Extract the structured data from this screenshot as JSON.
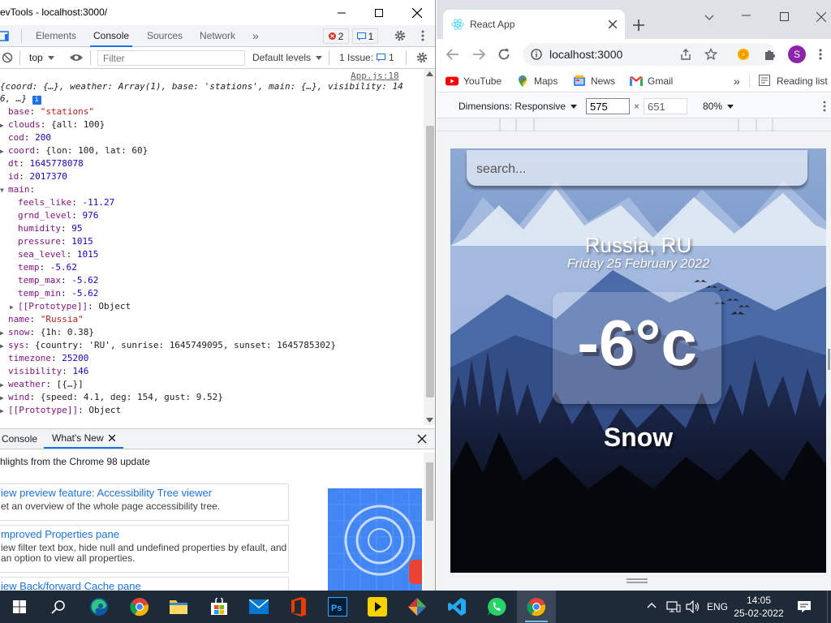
{
  "devtools": {
    "title": "evTools - localhost:3000/",
    "tabs": [
      "Elements",
      "Console",
      "Sources",
      "Network"
    ],
    "more_tabs": "»",
    "error_count": "2",
    "message_count": "1",
    "context": "top",
    "filter_placeholder": "Filter",
    "levels": "Default levels",
    "issues": "1 Issue:",
    "issues_count": "1",
    "source_link": "App.js:18",
    "summary_line1": "{coord: {…}, weather: Array(1), base: 'stations', main: {…}, visibility: 14",
    "summary_line2": "6, …}",
    "props": [
      {
        "indent": 0,
        "exp": "",
        "key": "base",
        "val": "\"stations\"",
        "t": "str"
      },
      {
        "indent": 0,
        "exp": "▶",
        "key": "clouds",
        "val": "{all: 100}",
        "t": "plain"
      },
      {
        "indent": 0,
        "exp": "",
        "key": "cod",
        "val": "200",
        "t": "num"
      },
      {
        "indent": 0,
        "exp": "▶",
        "key": "coord",
        "val": "{lon: 100, lat: 60}",
        "t": "plain"
      },
      {
        "indent": 0,
        "exp": "",
        "key": "dt",
        "val": "1645778078",
        "t": "num"
      },
      {
        "indent": 0,
        "exp": "",
        "key": "id",
        "val": "2017370",
        "t": "num"
      },
      {
        "indent": 0,
        "exp": "▼",
        "key": "main",
        "val": "",
        "t": "plain"
      },
      {
        "indent": 1,
        "exp": "",
        "key": "feels_like",
        "val": "-11.27",
        "t": "num"
      },
      {
        "indent": 1,
        "exp": "",
        "key": "grnd_level",
        "val": "976",
        "t": "num"
      },
      {
        "indent": 1,
        "exp": "",
        "key": "humidity",
        "val": "95",
        "t": "num"
      },
      {
        "indent": 1,
        "exp": "",
        "key": "pressure",
        "val": "1015",
        "t": "num"
      },
      {
        "indent": 1,
        "exp": "",
        "key": "sea_level",
        "val": "1015",
        "t": "num"
      },
      {
        "indent": 1,
        "exp": "",
        "key": "temp",
        "val": "-5.62",
        "t": "num"
      },
      {
        "indent": 1,
        "exp": "",
        "key": "temp_max",
        "val": "-5.62",
        "t": "num"
      },
      {
        "indent": 1,
        "exp": "",
        "key": "temp_min",
        "val": "-5.62",
        "t": "num"
      },
      {
        "indent": 1,
        "exp": "▶",
        "key": "[[Prototype]]",
        "val": "Object",
        "t": "plain"
      },
      {
        "indent": 0,
        "exp": "",
        "key": "name",
        "val": "\"Russia\"",
        "t": "str"
      },
      {
        "indent": 0,
        "exp": "▶",
        "key": "snow",
        "val": "{1h: 0.38}",
        "t": "plain"
      },
      {
        "indent": 0,
        "exp": "▶",
        "key": "sys",
        "val": "{country: 'RU', sunrise: 1645749095, sunset: 1645785302}",
        "t": "plain"
      },
      {
        "indent": 0,
        "exp": "",
        "key": "timezone",
        "val": "25200",
        "t": "num"
      },
      {
        "indent": 0,
        "exp": "",
        "key": "visibility",
        "val": "146",
        "t": "num"
      },
      {
        "indent": 0,
        "exp": "▶",
        "key": "weather",
        "val": "[{…}]",
        "t": "plain"
      },
      {
        "indent": 0,
        "exp": "▶",
        "key": "wind",
        "val": "{speed: 4.1, deg: 154, gust: 9.52}",
        "t": "plain"
      },
      {
        "indent": 0,
        "exp": "▶",
        "key": "[[Prototype]]",
        "val": "Object",
        "t": "plain"
      }
    ],
    "drawer": {
      "tabs": [
        "Console",
        "What's New"
      ],
      "headline": "hlights from the Chrome 98 update",
      "items": [
        {
          "title": "iew preview feature: Accessibility Tree viewer",
          "desc": "et an overview of the whole page accessibility tree."
        },
        {
          "title": "mproved Properties pane",
          "desc": "iew filter text box, hide null and undefined properties by efault, and an option to view all properties."
        },
        {
          "title": "iew Back/forward Cache pane",
          "desc": ""
        }
      ]
    }
  },
  "chrome": {
    "tab_title": "React App",
    "url": "localhost:3000",
    "profile_initial": "S",
    "bookmarks": [
      "YouTube",
      "Maps",
      "News",
      "Gmail"
    ],
    "reading_list": "Reading list",
    "device": {
      "mode": "Dimensions: Responsive",
      "width": "575",
      "height": "651",
      "zoom": "80%"
    },
    "app": {
      "search_placeholder": "search...",
      "location": "Russia, RU",
      "date": "Friday 25 February 2022",
      "temperature": "-6°c",
      "condition": "Snow"
    }
  },
  "taskbar": {
    "language": "ENG",
    "time": "14:05",
    "date": "25-02-2022"
  },
  "colors": {
    "accent": "#1a73e8",
    "taskbar": "#1f2a38",
    "error": "#d93025"
  }
}
